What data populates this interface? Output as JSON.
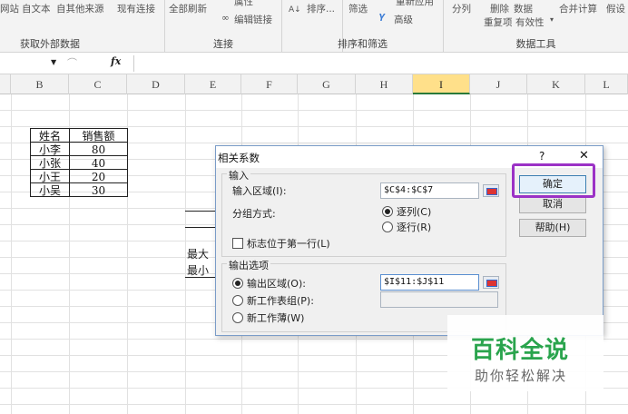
{
  "ribbon": {
    "items": {
      "web": "网站",
      "text": "自文本",
      "other_sources": "自其他来源",
      "existing": "现有连接",
      "refresh_all": "全部刷新",
      "properties": "属性",
      "edit_links": "编辑链接",
      "sort": "排序...",
      "filter": "筛选",
      "reapply": "重新应用",
      "advanced": "高级",
      "text_to_columns": "分列",
      "remove_duplicates_1": "删除",
      "remove_duplicates_2": "重复项",
      "data_validation_1": "数据",
      "data_validation_2": "有效性",
      "consolidate": "合并计算",
      "whatif": "假设"
    },
    "groups": {
      "get_external": "获取外部数据",
      "connections": "连接",
      "sort_filter": "排序和筛选",
      "data_tools": "数据工具"
    }
  },
  "formula_bar": {
    "fx": "fx"
  },
  "columns": [
    "B",
    "C",
    "D",
    "E",
    "F",
    "G",
    "H",
    "I",
    "J",
    "K",
    "L"
  ],
  "selected_column": "I",
  "table": {
    "headers": [
      "姓名",
      "销售额"
    ],
    "rows": [
      [
        "小李",
        "80"
      ],
      [
        "小张",
        "40"
      ],
      [
        "小王",
        "20"
      ],
      [
        "小吴",
        "30"
      ]
    ]
  },
  "sheet_partial": {
    "max_label": "最大",
    "min_label": "最小"
  },
  "dialog": {
    "title": "相关系数",
    "help_glyph": "?",
    "close_glyph": "✕",
    "input_section": "输入",
    "input_range_label": "输入区域(I):",
    "input_range_value": "$C$4:$C$7",
    "grouping_label": "分组方式:",
    "by_column": "逐列(C)",
    "by_row": "逐行(R)",
    "labels_first_row": "标志位于第一行(L)",
    "output_section": "输出选项",
    "output_range_label": "输出区域(O):",
    "output_range_value": "$I$11:$J$11",
    "new_sheet_label": "新工作表组(P):",
    "new_workbook_label": "新工作薄(W)",
    "ok": "确定",
    "cancel": "取消",
    "help": "帮助(H)"
  },
  "watermark": {
    "main": "百科全说",
    "sub": "助你轻松解决"
  },
  "colors": {
    "highlight": "#9b32c6",
    "watermark_green": "#2aa44d",
    "selected_col": "#ffe08a"
  }
}
